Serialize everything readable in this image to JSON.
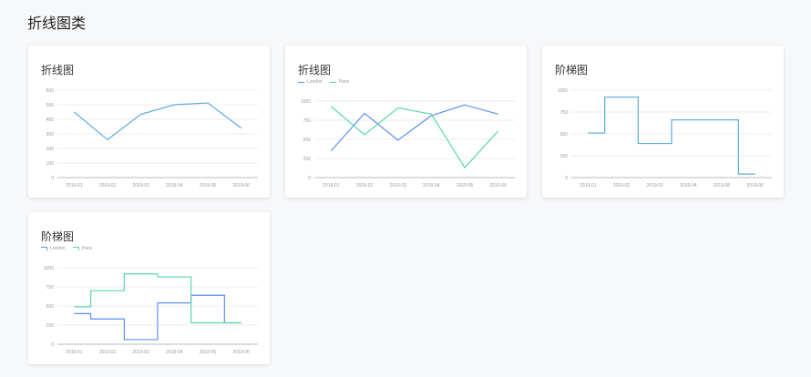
{
  "page": {
    "title": "折线图类"
  },
  "colors": {
    "london": "#5b8ff9",
    "paris": "#5ad8a6",
    "single": "#5aabdc",
    "grid": "#eeeeee",
    "axis": "#bbbbbb",
    "label": "#999999"
  },
  "cards": [
    {
      "title": "折线图",
      "legend": []
    },
    {
      "title": "折线图",
      "legend": [
        "London",
        "Paris"
      ]
    },
    {
      "title": "阶梯图",
      "legend": []
    },
    {
      "title": "阶梯图",
      "legend": [
        "London",
        "Paris"
      ]
    }
  ],
  "chart_data": [
    {
      "type": "line",
      "categories": [
        "2019-01",
        "2019-02",
        "2019-03",
        "2019-04",
        "2019-05",
        "2019-06"
      ],
      "ylim": [
        0,
        600
      ],
      "yticks": [
        0,
        100,
        200,
        300,
        400,
        500,
        600
      ],
      "series": [
        {
          "values": [
            450,
            260,
            435,
            500,
            512,
            340
          ],
          "color": "single"
        }
      ]
    },
    {
      "type": "line",
      "categories": [
        "2019-01",
        "2019-02",
        "2019-03",
        "2019-04",
        "2019-05",
        "2019-06"
      ],
      "ylim": [
        0,
        1000
      ],
      "yticks": [
        0,
        250,
        500,
        750,
        1000
      ],
      "series": [
        {
          "name": "London",
          "values": [
            350,
            840,
            490,
            810,
            950,
            830
          ],
          "color": "london"
        },
        {
          "name": "Paris",
          "values": [
            930,
            560,
            910,
            830,
            130,
            610
          ],
          "color": "paris"
        }
      ]
    },
    {
      "type": "line",
      "step": true,
      "categories": [
        "2019-01",
        "2019-02",
        "2019-03",
        "2019-04",
        "2019-05",
        "2019-06"
      ],
      "ylim": [
        0,
        1000
      ],
      "yticks": [
        0,
        250,
        500,
        750,
        1000
      ],
      "series": [
        {
          "values": [
            510,
            920,
            390,
            660,
            660,
            40
          ],
          "color": "single"
        }
      ]
    },
    {
      "type": "line",
      "step": true,
      "categories": [
        "2019-01",
        "2019-02",
        "2019-03",
        "2019-04",
        "2019-05",
        "2019-06"
      ],
      "ylim": [
        0,
        1000
      ],
      "yticks": [
        0,
        250,
        500,
        750,
        1000
      ],
      "series": [
        {
          "name": "London",
          "values": [
            400,
            330,
            60,
            540,
            640,
            280
          ],
          "color": "london"
        },
        {
          "name": "Paris",
          "values": [
            490,
            700,
            920,
            880,
            280,
            280
          ],
          "color": "paris"
        }
      ]
    }
  ]
}
